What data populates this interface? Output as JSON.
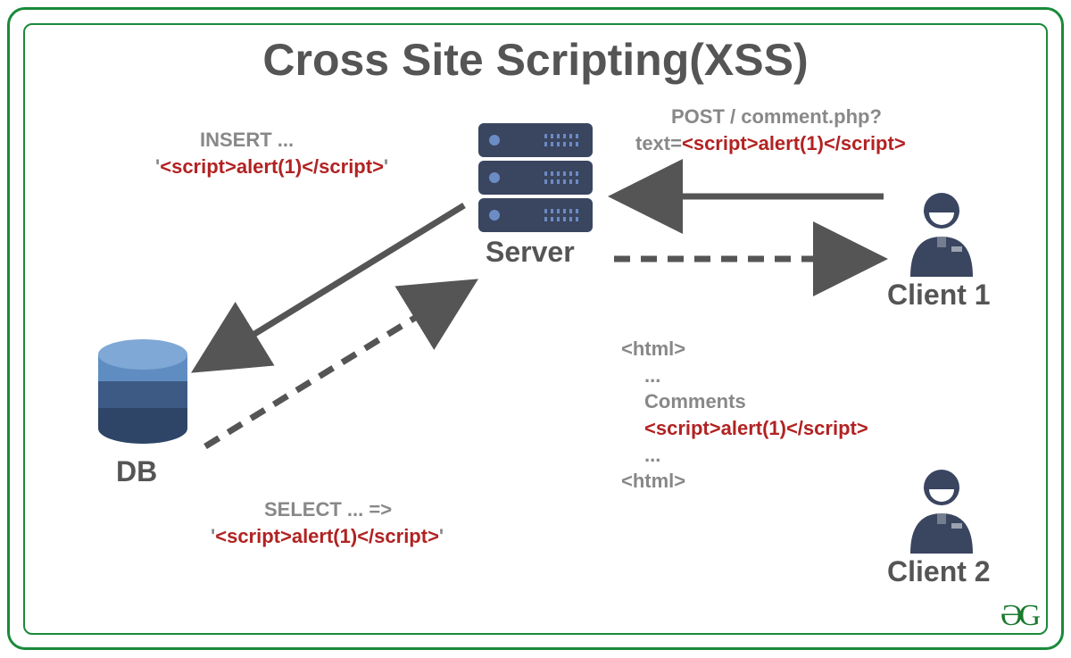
{
  "title": "Cross Site Scripting(XSS)",
  "nodes": {
    "server": "Server",
    "db": "DB",
    "client1": "Client 1",
    "client2": "Client 2"
  },
  "labels": {
    "insert_line1": "INSERT ...",
    "insert_quote_open": "'",
    "insert_red": "<script>alert(1)</script>",
    "insert_quote_close": "'",
    "post_line1": "POST / comment.php?",
    "post_prefix": "text=",
    "post_red": "<script>alert(1)</script>",
    "select_line1": "SELECT ... =>",
    "select_quote_open": "'",
    "select_red": "<script>alert(1)</script>",
    "select_quote_close": "'",
    "html_open": "<html>",
    "html_dots1": "...",
    "html_comments": "Comments",
    "html_red": "<script>alert(1)</script>",
    "html_dots2": "...",
    "html_close": "<html>"
  },
  "logo": "ƏG",
  "colors": {
    "frame": "#1a8a3a",
    "text_gray": "#888",
    "heading": "#555",
    "red": "#b22222",
    "server_body": "#3a4560",
    "person": "#3a4560"
  }
}
